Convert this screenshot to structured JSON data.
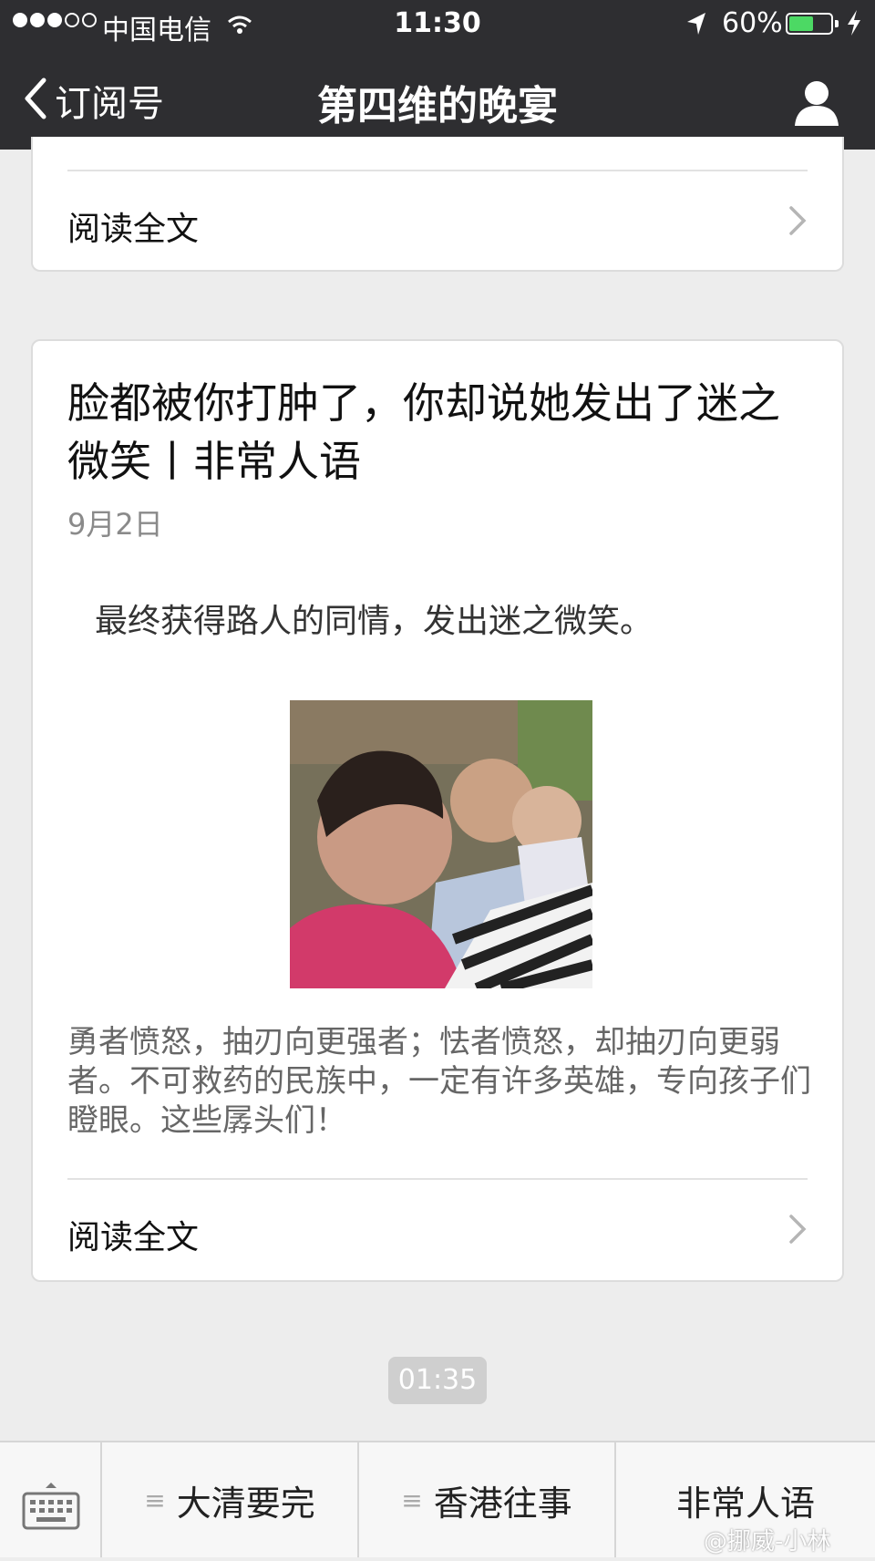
{
  "status_bar": {
    "carrier": "中国电信",
    "time": "11:30",
    "battery_percent": "60%",
    "battery_level": 0.6,
    "icons": [
      "signal-dots-icon",
      "wifi-icon",
      "location-arrow-icon",
      "battery-icon",
      "charging-bolt-icon"
    ]
  },
  "nav": {
    "back_label": "订阅号",
    "title": "第四维的晚宴",
    "icons": [
      "back-chevron-icon",
      "profile-icon"
    ]
  },
  "top_card": {
    "read_more": "阅读全文"
  },
  "article": {
    "title": "脸都被你打肿了，你却说她发出了迷之微笑丨非常人语",
    "date": "9月2日",
    "caption": "最终获得路人的同情，发出迷之微笑。",
    "summary": "勇者愤怒，抽刃向更强者；怯者愤怒，却抽刃向更弱者。不可救药的民族中，一定有许多英雄，专向孩子们瞪眼。这些孱头们！",
    "read_more": "阅读全文"
  },
  "time_pill": "01:35",
  "menu": {
    "items": [
      {
        "label": "大清要完",
        "icon": "menu-lines-icon"
      },
      {
        "label": "香港往事",
        "icon": "menu-lines-icon"
      },
      {
        "label": "非常人语",
        "icon": ""
      }
    ]
  },
  "watermark": "@挪威-小林",
  "colors": {
    "bar": "#2e2e31",
    "background": "#ededed",
    "battery": "#4cd964"
  }
}
